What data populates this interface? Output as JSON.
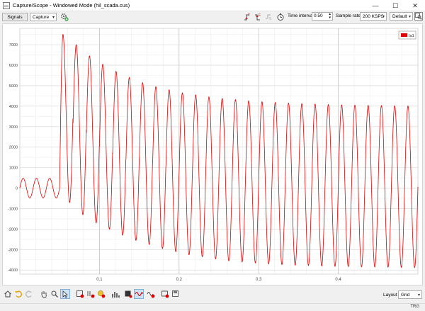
{
  "window": {
    "title": "Capture/Scope - Windowed Mode (hil_scada.cus)"
  },
  "toolbar": {
    "signals_label": "Signals",
    "mode_value": "Capture",
    "time_interval_label": "Time interval",
    "time_interval_value": "0.50",
    "sample_rate_label": "Sample rate",
    "sample_rate_value": "200 KSPS",
    "view_value": "Default"
  },
  "icons": [
    "app-icon",
    "minimize-icon",
    "maximize-icon",
    "close-icon",
    "settings-add-icon",
    "trigger-rising-icon",
    "trigger-falling-icon",
    "trigger-none-icon",
    "timer-icon",
    "zoom-fit-icon"
  ],
  "bottom": {
    "layout_label": "Layout",
    "layout_value": "Grid",
    "status_text": "TRG"
  },
  "colors": {
    "signal": "#e00000",
    "accent": "#0078d7"
  },
  "chart_data": {
    "type": "line",
    "title": "",
    "xlabel": "",
    "ylabel": "",
    "xlim": [
      0,
      0.5
    ],
    "ylim": [
      -4200,
      7800
    ],
    "x_ticks": [
      "0.1",
      "0.2",
      "0.3",
      "0.4"
    ],
    "y_ticks": [
      "7000",
      "6000",
      "5000",
      "4000",
      "3000",
      "2000",
      "1000",
      "0",
      "-1000",
      "-2000",
      "-3000",
      "-4000"
    ],
    "grid": true,
    "legend": "top-right",
    "series": [
      {
        "name": "Ia1",
        "color": "#e00000",
        "frequency_hz": 60,
        "segments": [
          {
            "x_start": 0.0,
            "x_end": 0.05,
            "amplitude": 480,
            "offset": 0
          },
          {
            "x_start": 0.05,
            "x_end": 0.5,
            "peaks": [
              7500,
              7000,
              6450,
              6050,
              5700,
              5400,
              5150,
              4950,
              4800,
              4650,
              4550,
              4450,
              4380,
              4320,
              4260,
              4220,
              4180,
              4150,
              4120,
              4100,
              4080,
              4060,
              4050,
              4040,
              4030,
              4020,
              4010
            ],
            "troughs": [
              -700,
              -1300,
              -1700,
              -2000,
              -2300,
              -2550,
              -2750,
              -2950,
              -3100,
              -3250,
              -3350,
              -3450,
              -3550,
              -3600,
              -3650,
              -3700,
              -3730,
              -3760,
              -3780,
              -3800,
              -3820,
              -3830,
              -3840,
              -3850,
              -3860,
              -3870,
              -3880
            ]
          }
        ]
      }
    ]
  }
}
